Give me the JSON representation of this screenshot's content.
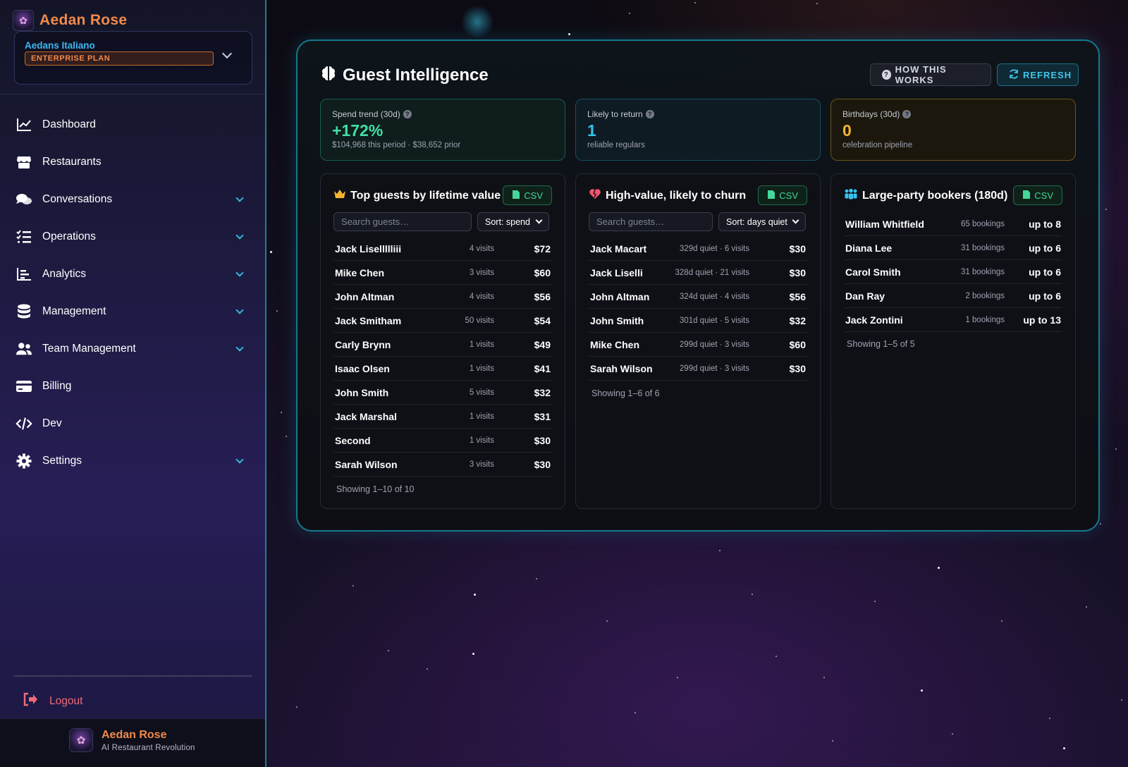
{
  "sidebar": {
    "brand": "Aedan Rose",
    "tenant": "Aedans Italiano",
    "plan": "ENTERPRISE PLAN",
    "nav": [
      {
        "label": "Dashboard",
        "icon": "chart-line-icon",
        "expandable": false
      },
      {
        "label": "Restaurants",
        "icon": "store-icon",
        "expandable": false
      },
      {
        "label": "Conversations",
        "icon": "comments-icon",
        "expandable": true
      },
      {
        "label": "Operations",
        "icon": "list-check-icon",
        "expandable": true
      },
      {
        "label": "Analytics",
        "icon": "bar-chart-icon",
        "expandable": true
      },
      {
        "label": "Management",
        "icon": "database-icon",
        "expandable": true
      },
      {
        "label": "Team Management",
        "icon": "users-icon",
        "expandable": true
      },
      {
        "label": "Billing",
        "icon": "credit-card-icon",
        "expandable": false
      },
      {
        "label": "Dev",
        "icon": "code-icon",
        "expandable": false
      },
      {
        "label": "Settings",
        "icon": "gear-icon",
        "expandable": true
      }
    ],
    "logout": "Logout",
    "footer": {
      "name": "Aedan Rose",
      "tagline": "AI Restaurant Revolution"
    }
  },
  "main": {
    "title": "Guest Intelligence",
    "how_button": "HOW THIS WORKS",
    "refresh_button": "REFRESH",
    "stats": [
      {
        "label": "Spend trend (30d)",
        "value": "+172%",
        "sub": "$104,968 this period · $38,652 prior",
        "color": "#3fe0a6"
      },
      {
        "label": "Likely to return",
        "value": "1",
        "sub": "reliable regulars",
        "color": "#36c4ef"
      },
      {
        "label": "Birthdays (30d)",
        "value": "0",
        "sub": "celebration pipeline",
        "color": "#f3b431"
      }
    ],
    "cards": {
      "top_guests": {
        "title": "Top guests by lifetime value",
        "csv": "CSV",
        "search_placeholder": "Search guests…",
        "sort": "Sort: spend",
        "rows": [
          {
            "name": "Jack Lisellllliii",
            "meta": "4 visits",
            "value": "$72"
          },
          {
            "name": "Mike Chen",
            "meta": "3 visits",
            "value": "$60"
          },
          {
            "name": "John Altman",
            "meta": "4 visits",
            "value": "$56"
          },
          {
            "name": "Jack Smitham",
            "meta": "50 visits",
            "value": "$54"
          },
          {
            "name": "Carly Brynn",
            "meta": "1 visits",
            "value": "$49"
          },
          {
            "name": "Isaac Olsen",
            "meta": "1 visits",
            "value": "$41"
          },
          {
            "name": "John Smith",
            "meta": "5 visits",
            "value": "$32"
          },
          {
            "name": "Jack Marshal",
            "meta": "1 visits",
            "value": "$31"
          },
          {
            "name": "Second",
            "meta": "1 visits",
            "value": "$30"
          },
          {
            "name": "Sarah Wilson",
            "meta": "3 visits",
            "value": "$30"
          }
        ],
        "showing": "Showing 1–10 of 10"
      },
      "churn": {
        "title": "High-value, likely to churn",
        "csv": "CSV",
        "search_placeholder": "Search guests…",
        "sort": "Sort: days quiet",
        "rows": [
          {
            "name": "Jack Macart",
            "meta": "329d quiet · 6 visits",
            "value": "$30"
          },
          {
            "name": "Jack Liselli",
            "meta": "328d quiet · 21 visits",
            "value": "$30"
          },
          {
            "name": "John Altman",
            "meta": "324d quiet · 4 visits",
            "value": "$56"
          },
          {
            "name": "John Smith",
            "meta": "301d quiet · 5 visits",
            "value": "$32"
          },
          {
            "name": "Mike Chen",
            "meta": "299d quiet · 3 visits",
            "value": "$60"
          },
          {
            "name": "Sarah Wilson",
            "meta": "299d quiet · 3 visits",
            "value": "$30"
          }
        ],
        "showing": "Showing 1–6 of 6"
      },
      "large_party": {
        "title": "Large-party bookers (180d)",
        "csv": "CSV",
        "rows": [
          {
            "name": "William Whitfield",
            "meta": "65 bookings",
            "value": "up to 8"
          },
          {
            "name": "Diana Lee",
            "meta": "31 bookings",
            "value": "up to 6"
          },
          {
            "name": "Carol Smith",
            "meta": "31 bookings",
            "value": "up to 6"
          },
          {
            "name": "Dan Ray",
            "meta": "2 bookings",
            "value": "up to 6"
          },
          {
            "name": "Jack Zontini",
            "meta": "1 bookings",
            "value": "up to 13"
          }
        ],
        "showing": "Showing 1–5 of 5"
      }
    }
  }
}
